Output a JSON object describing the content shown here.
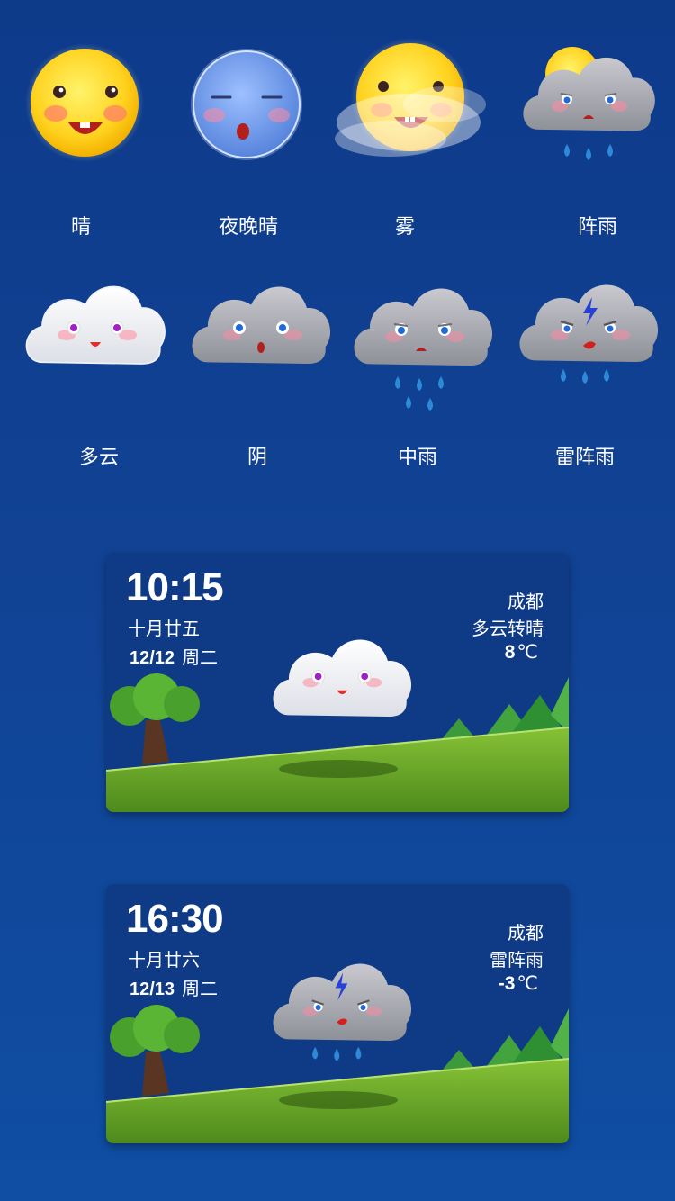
{
  "icons": [
    {
      "icon": "sun-face-icon",
      "label": "晴"
    },
    {
      "icon": "night-moon-face-icon",
      "label": "夜晚晴"
    },
    {
      "icon": "fog-sun-face-icon",
      "label": "雾"
    },
    {
      "icon": "shower-cloud-icon",
      "label": "阵雨"
    },
    {
      "icon": "partly-cloudy-cloud-icon",
      "label": "多云"
    },
    {
      "icon": "overcast-cloud-icon",
      "label": "阴"
    },
    {
      "icon": "moderate-rain-cloud-icon",
      "label": "中雨"
    },
    {
      "icon": "thunder-shower-cloud-icon",
      "label": "雷阵雨"
    }
  ],
  "widgets": [
    {
      "time": "10:15",
      "lunar": "十月廿五",
      "date": "12/12",
      "weekday": "周二",
      "city": "成都",
      "condition": "多云转晴",
      "temp": "8",
      "unit": "℃",
      "icon": "white-cloud-icon"
    },
    {
      "time": "16:30",
      "lunar": "十月廿六",
      "date": "12/13",
      "weekday": "周二",
      "city": "成都",
      "condition": "雷阵雨",
      "temp": "-3",
      "unit": "℃",
      "icon": "thunder-cloud-icon"
    }
  ],
  "colors": {
    "background": "#114395",
    "card": "#0f3b86",
    "grass": "#6aa82b",
    "sun": "#ffd21f",
    "moon": "#6d9ae6"
  }
}
